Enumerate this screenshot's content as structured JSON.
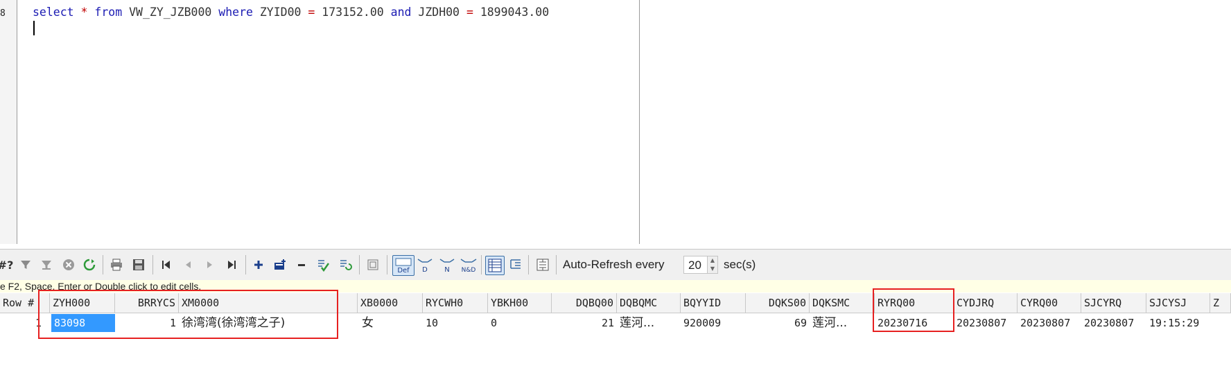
{
  "editor": {
    "line_number": "8",
    "sql": {
      "select": "select",
      "star": "*",
      "from": "from",
      "view": "VW_ZY_JZB000",
      "where": "where",
      "col1": "ZYID00",
      "eq1": "=",
      "val1": "173152.00",
      "and": "and",
      "col2": "JZDH00",
      "eq2": "=",
      "val2": "1899043.00"
    }
  },
  "toolbar": {
    "query_by_example": "#?",
    "auto_refresh_label": "Auto-Refresh every",
    "refresh_interval": "20",
    "sec_label": "sec(s)",
    "def_label": "Def",
    "d_label": "D",
    "n_label": "N",
    "nd_label": "N&D"
  },
  "hint": "e F2, Space, Enter or Double click to edit cells.",
  "grid": {
    "row_header": "Row #",
    "columns": [
      "ZYH000",
      "BRRYCS",
      "XM0000",
      "XB0000",
      "RYCWH0",
      "YBKH00",
      "DQBQ00",
      "DQBQMC",
      "BQYYID",
      "DQKS00",
      "DQKSMC",
      "RYRQ00",
      "CYDJRQ",
      "CYRQ00",
      "SJCYRQ",
      "SJCYSJ",
      "Z"
    ],
    "rows": [
      {
        "row_num": "1",
        "cells": [
          "83098",
          "1",
          "徐湾湾(徐湾湾之子)",
          "女",
          "10",
          "0",
          "21",
          "莲河...",
          "920009",
          "69",
          "莲河...",
          "20230716",
          "20230807",
          "20230807",
          "20230807",
          "19:15:29",
          ""
        ]
      }
    ]
  },
  "colors": {
    "highlight_border": "#e62020",
    "selected_cell": "#3399ff",
    "keyword": "#1b1bb3",
    "operator": "#c00000"
  }
}
